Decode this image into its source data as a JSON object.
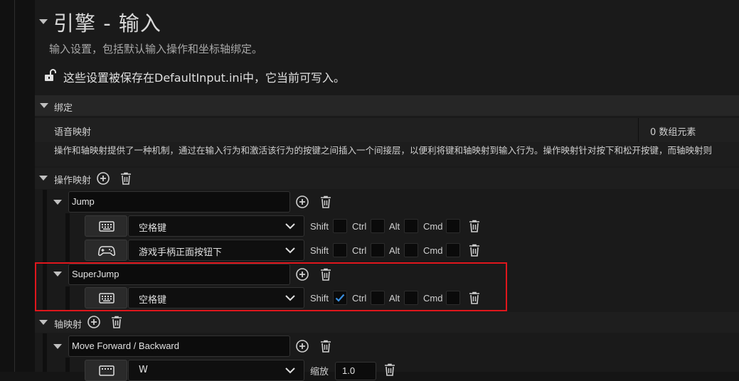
{
  "header": {
    "title": "引擎 - 输入",
    "subtitle": "输入设置，包括默认输入操作和坐标轴绑定。",
    "saved_note": "这些设置被保存在DefaultInput.ini中，它当前可写入。"
  },
  "bindings": {
    "section_label": "绑定",
    "speech_label": "语音映射",
    "speech_value": "0 数组元素",
    "description": "操作和轴映射提供了一种机制，通过在输入行为和激活该行为的按键之间插入一个间接层，以便利将键和轴映射到输入行为。操作映射针对按下和松开按键，而轴映射则"
  },
  "action_mappings": {
    "label": "操作映射",
    "modifiers": {
      "shift": "Shift",
      "ctrl": "Ctrl",
      "alt": "Alt",
      "cmd": "Cmd"
    },
    "items": [
      {
        "name": "Jump",
        "keys": [
          {
            "device_icon": "keyboard-icon",
            "key": "空格键",
            "shift": false
          },
          {
            "device_icon": "gamepad-icon",
            "key": "游戏手柄正面按钮下",
            "shift": false
          }
        ]
      },
      {
        "name": "SuperJump",
        "highlighted": true,
        "keys": [
          {
            "device_icon": "keyboard-icon",
            "key": "空格键",
            "shift": true
          }
        ]
      }
    ]
  },
  "axis_mappings": {
    "label": "轴映射",
    "items": [
      {
        "name": "Move Forward / Backward",
        "keys": [
          {
            "device_icon": "keyboard-icon",
            "key": "W",
            "scale_label": "缩放",
            "scale": "1.0"
          }
        ]
      }
    ]
  },
  "colors": {
    "highlight": "#e0161c",
    "check": "#3a8fe0"
  }
}
